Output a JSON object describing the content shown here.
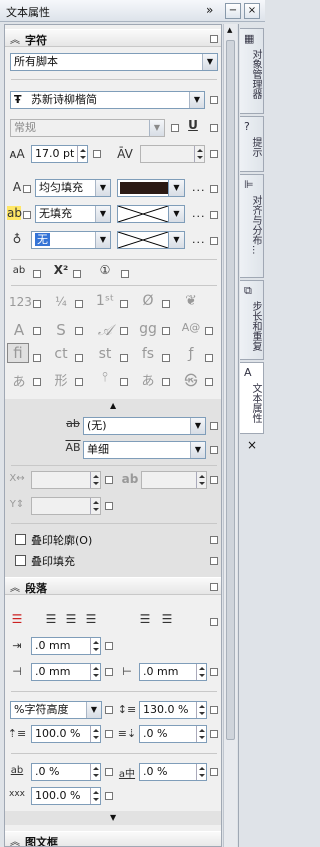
{
  "window": {
    "title": "文本属性",
    "pin_icon": "»",
    "min_icon": "−",
    "close_icon": "×"
  },
  "character": {
    "header": "字符",
    "script": "所有脚本",
    "font": "苏新诗柳楷简",
    "font_style": "常规",
    "size": "17.0 pt",
    "fill_type": "均匀填充",
    "bg_fill_type": "无填充",
    "outline_width": "无",
    "fill_color": "#2b1a14",
    "more": "..."
  },
  "dropdowns": {
    "strike": "(无)",
    "underline": "单细"
  },
  "checkboxes": {
    "overprint_outline": "叠印轮廓(O)",
    "overprint_fill": "叠印填充"
  },
  "paragraph": {
    "header": "段落",
    "first_indent": ".0 mm",
    "left_indent": ".0 mm",
    "right_indent": ".0 mm",
    "line_spacing_unit": "%字符高度",
    "line_spacing": "130.0 %",
    "before_para": "100.0 %",
    "after_para": ".0 %",
    "char_spacing": ".0 %",
    "word_spacing": ".0 %",
    "lang_spacing": "100.0 %"
  },
  "frame": {
    "header": "图文框"
  },
  "tabs": [
    {
      "label": "对象管理器",
      "icon": "▦"
    },
    {
      "label": "提示",
      "icon": "?"
    },
    {
      "label": "对齐与分布...",
      "icon": "⊫"
    },
    {
      "label": "步长和重复",
      "icon": "⧉"
    },
    {
      "label": "文本属性",
      "icon": "A"
    }
  ]
}
